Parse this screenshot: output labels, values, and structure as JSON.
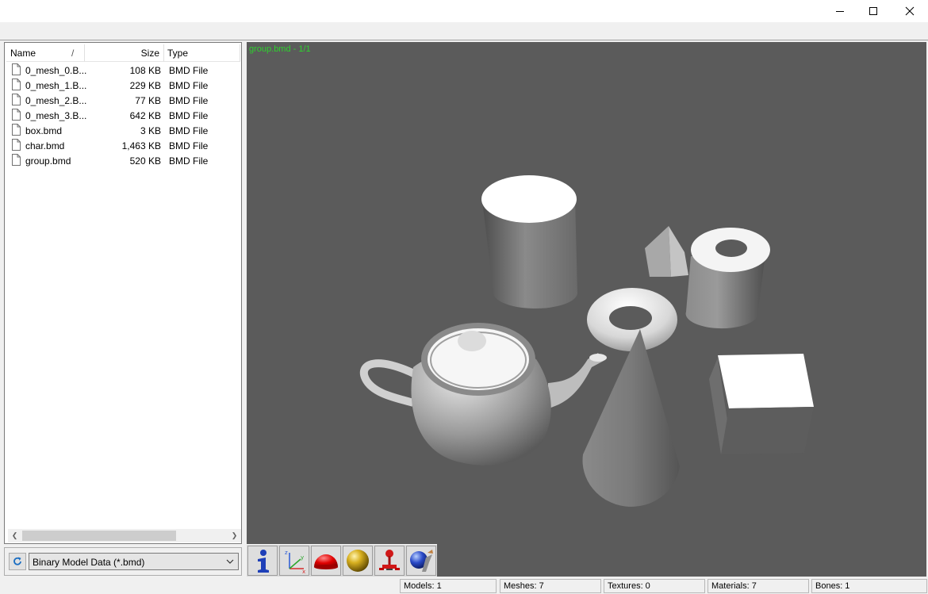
{
  "window": {
    "minimize_label": "Minimize",
    "maximize_label": "Maximize",
    "close_label": "Close"
  },
  "file_list": {
    "columns": {
      "name": "Name",
      "sort_glyph": "/",
      "size": "Size",
      "type": "Type"
    },
    "rows": [
      {
        "name": "0_mesh_0.B...",
        "size": "108 KB",
        "type": "BMD File"
      },
      {
        "name": "0_mesh_1.B...",
        "size": "229 KB",
        "type": "BMD File"
      },
      {
        "name": "0_mesh_2.B...",
        "size": "77 KB",
        "type": "BMD File"
      },
      {
        "name": "0_mesh_3.B...",
        "size": "642 KB",
        "type": "BMD File"
      },
      {
        "name": "box.bmd",
        "size": "3 KB",
        "type": "BMD File"
      },
      {
        "name": "char.bmd",
        "size": "1,463 KB",
        "type": "BMD File"
      },
      {
        "name": "group.bmd",
        "size": "520 KB",
        "type": "BMD File"
      }
    ],
    "file_icon": "document-icon"
  },
  "filter": {
    "selected": "Binary Model Data (*.bmd)"
  },
  "viewport": {
    "title": "group.bmd - 1/1",
    "title_color": "#2ed12e",
    "background": "#5b5b5b"
  },
  "toolbar": {
    "buttons": [
      {
        "icon": "info-icon"
      },
      {
        "icon": "axes-icon"
      },
      {
        "icon": "red-dome-icon"
      },
      {
        "icon": "gold-sphere-icon"
      },
      {
        "icon": "joystick-icon"
      },
      {
        "icon": "sphere-brush-icon"
      }
    ]
  },
  "status": {
    "models": "Models: 1",
    "meshes": "Meshes: 7",
    "textures": "Textures: 0",
    "materials": "Materials: 7",
    "bones": "Bones: 1"
  }
}
